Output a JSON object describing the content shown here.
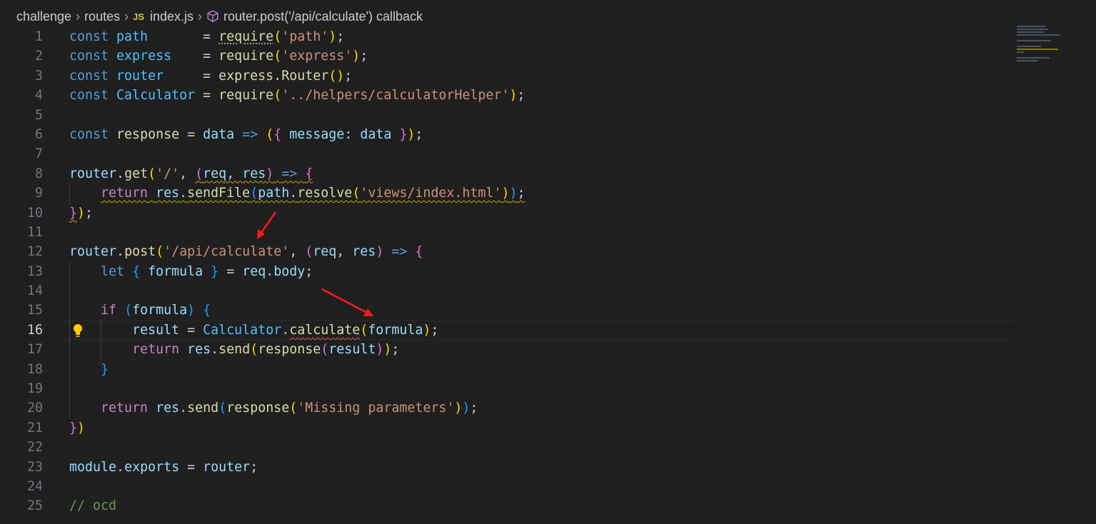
{
  "breadcrumb": {
    "folder1": "challenge",
    "folder2": "routes",
    "file_badge": "JS",
    "file": "index.js",
    "symbol": "router.post('/api/calculate') callback"
  },
  "editor": {
    "active_line": 16,
    "line_numbers": [
      "1",
      "2",
      "3",
      "4",
      "5",
      "6",
      "7",
      "8",
      "9",
      "10",
      "11",
      "12",
      "13",
      "14",
      "15",
      "16",
      "17",
      "18",
      "19",
      "20",
      "21",
      "22",
      "23",
      "24",
      "25"
    ],
    "lines": [
      "const path       = require('path');",
      "const express    = require('express');",
      "const router     = express.Router();",
      "const Calculator = require('../helpers/calculatorHelper');",
      "",
      "const response = data => ({ message: data });",
      "",
      "router.get('/', (req, res) => {",
      "    return res.sendFile(path.resolve('views/index.html'));",
      "});",
      "",
      "router.post('/api/calculate', (req, res) => {",
      "    let { formula } = req.body;",
      "",
      "    if (formula) {",
      "        result = Calculator.calculate(formula);",
      "        return res.send(response(result));",
      "    }",
      "",
      "    return res.send(response('Missing parameters'));",
      "})",
      "",
      "module.exports = router;",
      "",
      "// ocd"
    ]
  },
  "colors": {
    "background": "#1f1f1f",
    "keyword": "#569cd6",
    "control": "#c586c0",
    "variable": "#9cdcfe",
    "constant": "#4fc1ff",
    "function": "#dcdcaa",
    "string": "#ce9178",
    "comment": "#6a9955",
    "arrow_annotation": "#ff1a1a",
    "lightbulb": "#ffcc00"
  },
  "icons": {
    "breadcrumb_separator": "chevron-right-icon",
    "symbol": "cube-method-icon",
    "quick_fix": "lightbulb-icon"
  }
}
